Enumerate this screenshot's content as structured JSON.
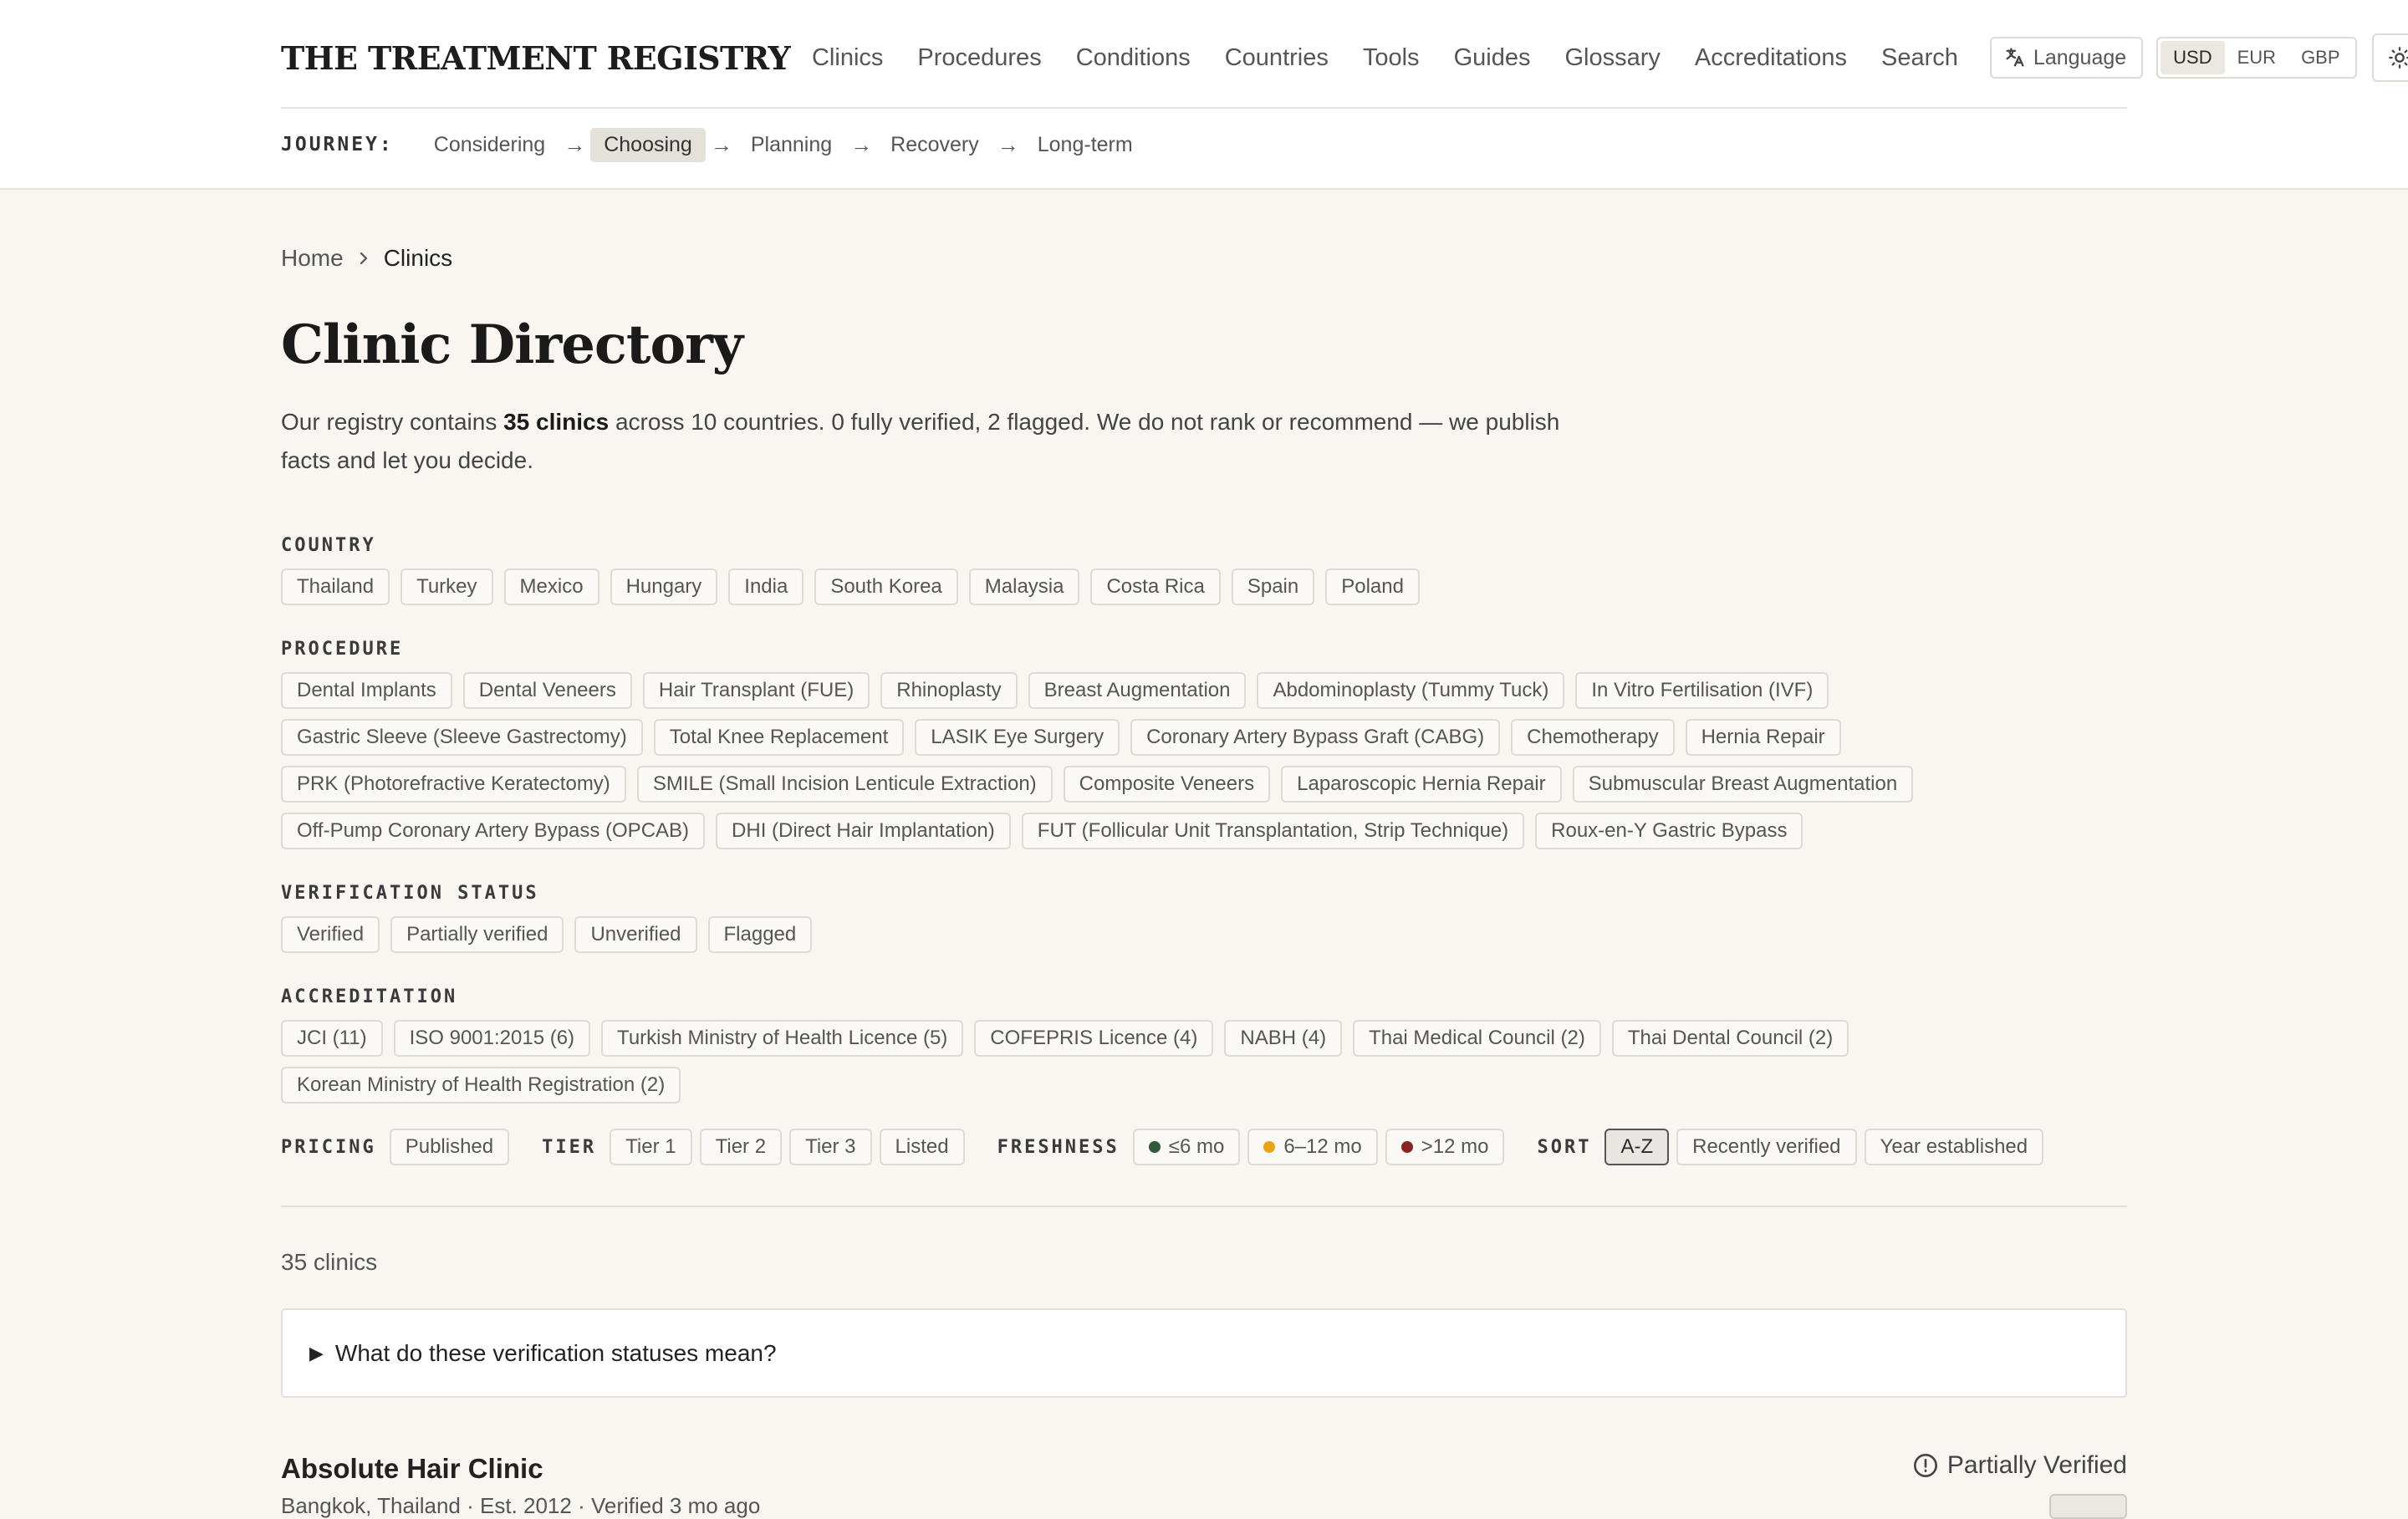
{
  "brand": "THE TREATMENT REGISTRY",
  "nav": {
    "items": [
      "Clinics",
      "Procedures",
      "Conditions",
      "Countries",
      "Tools",
      "Guides",
      "Glossary",
      "Accreditations",
      "Search"
    ],
    "active": "Clinics",
    "language_label": "Language",
    "currencies": [
      "USD",
      "EUR",
      "GBP"
    ],
    "active_currency": "USD",
    "theme_modes": [
      "light-icon",
      "dark-icon",
      "system-icon"
    ],
    "active_theme": "system"
  },
  "journey": {
    "label": "JOURNEY:",
    "steps": [
      "Considering",
      "Choosing",
      "Planning",
      "Recovery",
      "Long-term"
    ],
    "active": "Choosing",
    "separator": "→"
  },
  "breadcrumb": {
    "home": "Home",
    "current": "Clinics"
  },
  "page": {
    "title": "Clinic Directory",
    "intro_prefix": "Our registry contains ",
    "intro_count": "35 clinics",
    "intro_suffix": " across 10 countries. 0 fully verified, 2 flagged. We do not rank or recommend — we publish facts and let you decide."
  },
  "filters": {
    "country": {
      "label": "COUNTRY",
      "options": [
        "Thailand",
        "Turkey",
        "Mexico",
        "Hungary",
        "India",
        "South Korea",
        "Malaysia",
        "Costa Rica",
        "Spain",
        "Poland"
      ]
    },
    "procedure": {
      "label": "PROCEDURE",
      "options": [
        "Dental Implants",
        "Dental Veneers",
        "Hair Transplant (FUE)",
        "Rhinoplasty",
        "Breast Augmentation",
        "Abdominoplasty (Tummy Tuck)",
        "In Vitro Fertilisation (IVF)",
        "Gastric Sleeve (Sleeve Gastrectomy)",
        "Total Knee Replacement",
        "LASIK Eye Surgery",
        "Coronary Artery Bypass Graft (CABG)",
        "Chemotherapy",
        "Hernia Repair",
        "PRK (Photorefractive Keratectomy)",
        "SMILE (Small Incision Lenticule Extraction)",
        "Composite Veneers",
        "Laparoscopic Hernia Repair",
        "Submuscular Breast Augmentation",
        "Off-Pump Coronary Artery Bypass (OPCAB)",
        "DHI (Direct Hair Implantation)",
        "FUT (Follicular Unit Transplantation, Strip Technique)",
        "Roux-en-Y Gastric Bypass"
      ]
    },
    "verification": {
      "label": "VERIFICATION STATUS",
      "options": [
        "Verified",
        "Partially verified",
        "Unverified",
        "Flagged"
      ]
    },
    "accreditation": {
      "label": "ACCREDITATION",
      "options": [
        "JCI (11)",
        "ISO 9001:2015 (6)",
        "Turkish Ministry of Health Licence (5)",
        "COFEPRIS Licence (4)",
        "NABH (4)",
        "Thai Medical Council (2)",
        "Thai Dental Council (2)",
        "Korean Ministry of Health Registration (2)"
      ]
    },
    "pricing": {
      "label": "PRICING",
      "options": [
        "Published"
      ]
    },
    "tier": {
      "label": "TIER",
      "options": [
        "Tier 1",
        "Tier 2",
        "Tier 3",
        "Listed"
      ]
    },
    "freshness": {
      "label": "FRESHNESS",
      "options": [
        {
          "label": "≤6 mo",
          "color": "#2f5a3c"
        },
        {
          "label": "6–12 mo",
          "color": "#e8a317"
        },
        {
          "label": ">12 mo",
          "color": "#8b2222"
        }
      ]
    },
    "sort": {
      "label": "SORT",
      "options": [
        "A-Z",
        "Recently verified",
        "Year established"
      ],
      "active": "A-Z"
    }
  },
  "results": {
    "count": "35 clinics",
    "explainer": "What do these verification statuses mean?",
    "first_clinic": {
      "name": "Absolute Hair Clinic",
      "meta": "Bangkok, Thailand · Est. 2012 · Verified 3 mo ago",
      "status": "Partially Verified"
    }
  }
}
